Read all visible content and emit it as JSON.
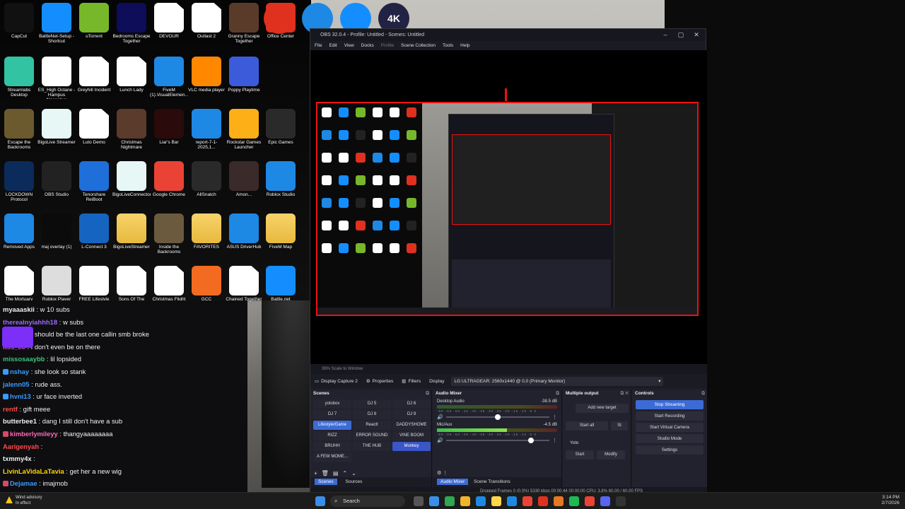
{
  "desktop": {
    "icons": [
      {
        "label": "CapCut",
        "kind": "app",
        "color": "#111111",
        "col": 0,
        "row": 0
      },
      {
        "label": "BattleNet-Setup - Shortcut",
        "kind": "app",
        "color": "#148eff",
        "col": 1,
        "row": 0
      },
      {
        "label": "uTorrent",
        "kind": "app",
        "color": "#76b82a",
        "col": 2,
        "row": 0
      },
      {
        "label": "Bedrooms Escape Together",
        "kind": "app",
        "color": "#0d0d5a",
        "col": 3,
        "row": 0
      },
      {
        "label": "DEVOUR",
        "kind": "doc",
        "color": "#ffffff",
        "col": 4,
        "row": 0
      },
      {
        "label": "Outlast 2",
        "kind": "doc",
        "color": "#ffffff",
        "col": 5,
        "row": 0
      },
      {
        "label": "Granny Escape Together",
        "kind": "app",
        "color": "#5a3b2a",
        "col": 6,
        "row": 0
      },
      {
        "label": "Streamlabs Desktop",
        "kind": "app",
        "color": "#31c3a2",
        "col": 0,
        "row": 1
      },
      {
        "label": "ES_High Octane - Hampus Naeselius",
        "kind": "app",
        "color": "#ffffff",
        "col": 1,
        "row": 1
      },
      {
        "label": "Greyhill Incident",
        "kind": "doc",
        "color": "#ffffff",
        "col": 2,
        "row": 1
      },
      {
        "label": "Lunch Lady",
        "kind": "doc",
        "color": "#ffffff",
        "col": 3,
        "row": 1
      },
      {
        "label": "FiveM (1).VisualElemen...",
        "kind": "app",
        "color": "#1e88e5",
        "col": 4,
        "row": 1
      },
      {
        "label": "VLC media player",
        "kind": "app",
        "color": "#ff8800",
        "col": 5,
        "row": 1
      },
      {
        "label": "Poppy Playtime",
        "kind": "app",
        "color": "#3b5bdb",
        "col": 6,
        "row": 1
      },
      {
        "label": "Escape the Backrooms",
        "kind": "app",
        "color": "#6b5a2e",
        "col": 0,
        "row": 2
      },
      {
        "label": "BigoLive Streamer",
        "kind": "app",
        "color": "#e6f7f5",
        "col": 1,
        "row": 2
      },
      {
        "label": "Luto Demo",
        "kind": "doc",
        "color": "#ffffff",
        "col": 2,
        "row": 2
      },
      {
        "label": "Christmas Nightmare",
        "kind": "app",
        "color": "#5b3b2b",
        "col": 3,
        "row": 2
      },
      {
        "label": "Liar's Bar",
        "kind": "app",
        "color": "#2a0a0a",
        "col": 4,
        "row": 2
      },
      {
        "label": "report-7-1-2025,1...",
        "kind": "app",
        "color": "#1e88e5",
        "col": 5,
        "row": 2
      },
      {
        "label": "Rockstar Games Launcher",
        "kind": "app",
        "color": "#fcaf17",
        "col": 6,
        "row": 2
      },
      {
        "label": "LOCKDOWN Protocol",
        "kind": "app",
        "color": "#0b2b5b",
        "col": 0,
        "row": 3
      },
      {
        "label": "OBS Studio",
        "kind": "app",
        "color": "#222222",
        "col": 1,
        "row": 3
      },
      {
        "label": "Tenorshare ReiBoot",
        "kind": "app",
        "color": "#1e6fd9",
        "col": 2,
        "row": 3
      },
      {
        "label": "BigoLiveConnector",
        "kind": "app",
        "color": "#e6f7f5",
        "col": 3,
        "row": 3
      },
      {
        "label": "Google Chrome",
        "kind": "app",
        "color": "#ea4335",
        "col": 4,
        "row": 3
      },
      {
        "label": "AllSnatch",
        "kind": "app",
        "color": "#2a2a2a",
        "col": 5,
        "row": 3
      },
      {
        "label": "Amon...",
        "kind": "app",
        "color": "#3a2a2a",
        "col": 6,
        "row": 3
      },
      {
        "label": "Removed Apps",
        "kind": "app",
        "color": "#1e88e5",
        "col": 0,
        "row": 4
      },
      {
        "label": "maj overlay (1)",
        "kind": "app",
        "color": "#0b0b0b",
        "col": 1,
        "row": 4
      },
      {
        "label": "L-Connect 3",
        "kind": "app",
        "color": "#1565c0",
        "col": 2,
        "row": 4
      },
      {
        "label": "BigoLiveStreamer",
        "kind": "folder",
        "color": "#f6d36b",
        "col": 3,
        "row": 4
      },
      {
        "label": "Inside the Backrooms",
        "kind": "app",
        "color": "#6b5a3e",
        "col": 4,
        "row": 4
      },
      {
        "label": "FAVORITES",
        "kind": "folder",
        "color": "#f6d36b",
        "col": 5,
        "row": 4
      },
      {
        "label": "ASUS DriverHub",
        "kind": "app",
        "color": "#1e88e5",
        "col": 6,
        "row": 4
      },
      {
        "label": "The Mortuary",
        "kind": "doc",
        "color": "#ffffff",
        "col": 0,
        "row": 5
      },
      {
        "label": "Roblox Player",
        "kind": "app",
        "color": "#dddddd",
        "col": 1,
        "row": 5
      },
      {
        "label": "FREE Lifestyle Tutorial Audio",
        "kind": "app",
        "color": "#ffffff",
        "col": 2,
        "row": 5
      },
      {
        "label": "Sons Of The Forest",
        "kind": "doc",
        "color": "#ffffff",
        "col": 3,
        "row": 5
      },
      {
        "label": "Christmas Flight",
        "kind": "doc",
        "color": "#ffffff",
        "col": 4,
        "row": 5
      },
      {
        "label": "GCC",
        "kind": "app",
        "color": "#f26b21",
        "col": 5,
        "row": 5
      },
      {
        "label": "Chained Together",
        "kind": "doc",
        "color": "#ffffff",
        "col": 6,
        "row": 5
      }
    ],
    "right_icons": [
      {
        "label": "Office Center",
        "kind": "app",
        "color": "#e0301e",
        "col": 0,
        "row": 0
      },
      {
        "label": "Epic Games",
        "kind": "app",
        "color": "#2a2a2a",
        "col": 0,
        "row": 2
      },
      {
        "label": "Roblox Studio",
        "kind": "app",
        "color": "#1e88e5",
        "col": 0,
        "row": 3
      },
      {
        "label": "FiveM Map",
        "kind": "folder",
        "color": "#f6d36b",
        "col": 0,
        "row": 4
      },
      {
        "label": "Battle.net",
        "kind": "app",
        "color": "#148eff",
        "col": 0,
        "row": 5
      }
    ],
    "top_extra_icons": [
      {
        "name": "office-icon",
        "color": "#e0301e"
      },
      {
        "name": "edge-icon",
        "color": "#1e88e5"
      },
      {
        "name": "battlenet-icon",
        "color": "#148eff"
      },
      {
        "name": "4k-icon",
        "color": "#222244",
        "text": "4K"
      }
    ]
  },
  "chat": {
    "messages": [
      {
        "user": "myaaaskii",
        "text": ": w 10 subs",
        "color": "#efeff1",
        "badge": ""
      },
      {
        "user": "therealnyiahhh18",
        "text": ": w subs",
        "color": "#9b6bff",
        "badge": ""
      },
      {
        "user": "aylxrrr",
        "text": ": u should be the last one callin smb broke",
        "color": "#9b6bff",
        "badge": ""
      },
      {
        "user": "itss_cc",
        "text": ": I don't even be on there",
        "color": "#c04bd8",
        "badge": ""
      },
      {
        "user": "missosaaybb",
        "text": ": lil lopsided",
        "color": "#3ec27a",
        "badge": ""
      },
      {
        "user": "nshay",
        "text": ": she look so stank",
        "color": "#3a9bff",
        "badge": "#3a9bff"
      },
      {
        "user": "jalenn05",
        "text": ": rude ass.",
        "color": "#3a9bff",
        "badge": ""
      },
      {
        "user": "hvni13",
        "text": ": ur face inverted",
        "color": "#3a9bff",
        "badge": "#3a9bff"
      },
      {
        "user": "rentf",
        "text": ": gift meee",
        "color": "#ff4a4a",
        "badge": ""
      },
      {
        "user": "butterbee1",
        "text": ": dang I still don't have a sub",
        "color": "#efeff1",
        "badge": ""
      },
      {
        "user": "kimberlymileyy",
        "text": ": thangyaaaaaaaa",
        "color": "#ff69b4",
        "badge": "#d9476a"
      },
      {
        "user": "Aarigenyah",
        "text": ":",
        "color": "#ff4a4a",
        "badge": ""
      },
      {
        "user": "txmmy4x",
        "text": ":",
        "color": "#efeff1",
        "badge": ""
      },
      {
        "user": "LivinLaVidaLaTavia",
        "text": ": get her a new wig",
        "color": "#ffd700",
        "badge": ""
      },
      {
        "user": "Dejamae",
        "text": ": imajmob",
        "color": "#3a9bff",
        "badge": "#d9476a"
      }
    ]
  },
  "obs": {
    "title": "OBS 32.0.4 - Profile: Untitled - Scenes: Untitled",
    "menu": [
      "File",
      "Edit",
      "View",
      "Docks",
      "Profile",
      "Scene Collection",
      "Tools",
      "Help"
    ],
    "zoom_text": "36%    Scale to Window",
    "source_name": "Display Capture 2",
    "properties_label": "Properties",
    "filters_label": "Filters",
    "display_label": "Display",
    "display_value": "LG ULTRAGEAR: 2560x1440 @ 0,0 (Primary Monitor)",
    "scenes_title": "Scenes",
    "scenes": [
      {
        "name": "yolobox",
        "state": ""
      },
      {
        "name": "DJ 5",
        "state": ""
      },
      {
        "name": "DJ 6",
        "state": ""
      },
      {
        "name": "DJ 7",
        "state": ""
      },
      {
        "name": "DJ 8",
        "state": ""
      },
      {
        "name": "DJ 9",
        "state": ""
      },
      {
        "name": "Lifestyle/Game",
        "state": "active"
      },
      {
        "name": "Reactt",
        "state": ""
      },
      {
        "name": "DADDYSHOME",
        "state": ""
      },
      {
        "name": "RIZZ",
        "state": ""
      },
      {
        "name": "ERROR SOUND",
        "state": ""
      },
      {
        "name": "VINE BOOM",
        "state": ""
      },
      {
        "name": "BRUHH",
        "state": ""
      },
      {
        "name": "THE HUB",
        "state": ""
      },
      {
        "name": "Monkey",
        "state": "sel"
      },
      {
        "name": "A FEW MOME...",
        "state": ""
      }
    ],
    "scenes_tab": "Scenes",
    "sources_tab": "Sources",
    "mixer_title": "Audio Mixer",
    "channels": [
      {
        "name": "Desktop Audio",
        "db": "-38.5 dB",
        "level": 0.0,
        "vol": 0.5
      },
      {
        "name": "Mic/Aux",
        "db": "-4.5 dB",
        "level": 0.58,
        "vol": 0.82
      }
    ],
    "ticks": "-60 -55 -50 -45 -40 -35 -30 -25 -20 -15 -10 -5 0",
    "mixer_tab": "Audio Mixer",
    "transitions_tab": "Scene Transitions",
    "multi_title": "Multiple output",
    "multi_add": "Add new target",
    "multi_startall": "Start all",
    "multi_stop": "St",
    "multi_target": "Yolo",
    "multi_start": "Start",
    "multi_modify": "Modify",
    "controls_title": "Controls",
    "controls": [
      "Stop Streaming",
      "Start Recording",
      "Start Virtual Camera",
      "Studio Mode",
      "Settings"
    ],
    "status": "Dropped Frames 0 (0.0%)     5330 kbps     00:00:44     00:00:00     CPU: 3.8%     60.00 / 60.00 FPS"
  },
  "taskbar": {
    "weather_title": "Wind advisory",
    "weather_sub": "In effect",
    "search_placeholder": "Search",
    "time": "3:14 PM",
    "date": "2/7/2026"
  },
  "colors": {
    "accent": "#3d6bd6",
    "preview_border": "#e11111",
    "chat_bg": "#0e0e10"
  }
}
